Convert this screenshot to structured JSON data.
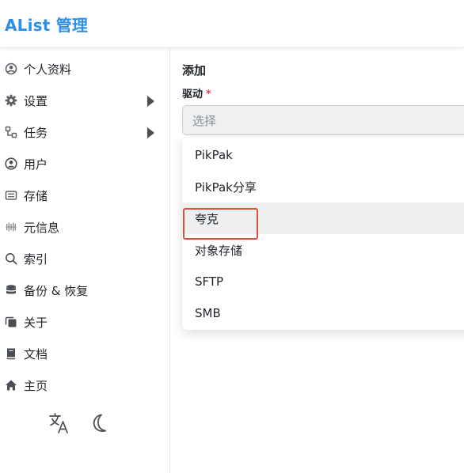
{
  "app": {
    "title": "AList 管理"
  },
  "sidebar": {
    "items": [
      {
        "label": "个人资料",
        "icon": "user-circle-icon",
        "has_arrow": false
      },
      {
        "label": "设置",
        "icon": "gear-icon",
        "has_arrow": true
      },
      {
        "label": "任务",
        "icon": "task-tree-icon",
        "has_arrow": true
      },
      {
        "label": "用户",
        "icon": "user-icon",
        "has_arrow": false
      },
      {
        "label": "存储",
        "icon": "storage-icon",
        "has_arrow": false
      },
      {
        "label": "元信息",
        "icon": "meta-icon",
        "has_arrow": false
      },
      {
        "label": "索引",
        "icon": "search-icon",
        "has_arrow": false
      },
      {
        "label": "备份 & 恢复",
        "icon": "database-icon",
        "has_arrow": false
      },
      {
        "label": "关于",
        "icon": "copy-icon",
        "has_arrow": false
      },
      {
        "label": "文档",
        "icon": "book-icon",
        "has_arrow": false
      },
      {
        "label": "主页",
        "icon": "home-icon",
        "has_arrow": false
      }
    ],
    "footer": {
      "language_icon": "translate-icon",
      "theme_icon": "moon-icon"
    }
  },
  "main": {
    "title": "添加",
    "driver_field": {
      "label": "驱动",
      "required_mark": "*",
      "placeholder": "选择"
    },
    "dropdown": {
      "options": [
        "PikPak",
        "PikPak分享",
        "夸克",
        "对象存储",
        "SFTP",
        "SMB"
      ],
      "highlighted": "夸克"
    }
  },
  "colors": {
    "brand": "#2f8fe6",
    "required": "#e5484d",
    "highlight_box": "#d9533c",
    "option_hover": "#eeeff1"
  }
}
